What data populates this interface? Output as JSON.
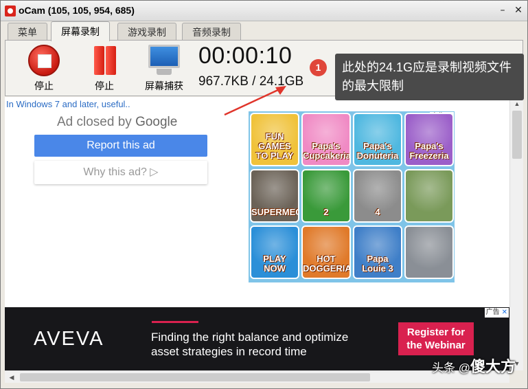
{
  "window": {
    "title": "oCam (105, 105, 954, 685)"
  },
  "tabs": [
    {
      "label": "菜单"
    },
    {
      "label": "屏幕录制"
    },
    {
      "label": "游戏录制"
    },
    {
      "label": "音频录制"
    }
  ],
  "toolbar": {
    "stop_label": "停止",
    "pause_label": "停止",
    "capture_label": "屏幕捕获",
    "timer": "00:00:10",
    "size": "967.7KB / 24.1GB"
  },
  "annotation": {
    "badge": "1",
    "text": "此处的24.1G应是录制视频文件的最大限制"
  },
  "content": {
    "note": "In Windows 7 and later, useful..",
    "ad_closed_prefix": "Ad closed by ",
    "ad_closed_brand": "Google",
    "report_button": "Report this ad",
    "why_button": "Why this ad? ▷"
  },
  "games_ad": {
    "tag": "广告",
    "tiles": [
      {
        "label": "FUN GAMES TO PLAY",
        "color": "#f0c23a"
      },
      {
        "label": "Papa's Cupcakeria",
        "color": "#f08ac4"
      },
      {
        "label": "Papa's Donuteria",
        "color": "#4fb8e0"
      },
      {
        "label": "Papa's Freezeria",
        "color": "#9b5fc9"
      },
      {
        "label": "SUPERMECHS",
        "color": "#6b6257"
      },
      {
        "label": "2",
        "color": "#3a9a3a"
      },
      {
        "label": "4",
        "color": "#8c8c8c"
      },
      {
        "label": "",
        "color": "#7a9a5a"
      },
      {
        "label": "PLAY NOW",
        "color": "#2b8fd8"
      },
      {
        "label": "HOT DOGGERIA",
        "color": "#e07a2a"
      },
      {
        "label": "Papa Louie 3",
        "color": "#3f7fc8"
      },
      {
        "label": "",
        "color": "#8a8f96"
      }
    ]
  },
  "banner": {
    "tag": "广告",
    "brand": "AVEVA",
    "text": "Finding the right balance and optimize asset strategies in record time",
    "button": "Register for the Webinar"
  },
  "watermark": {
    "prefix": "头条 @",
    "big": "傻大方"
  }
}
